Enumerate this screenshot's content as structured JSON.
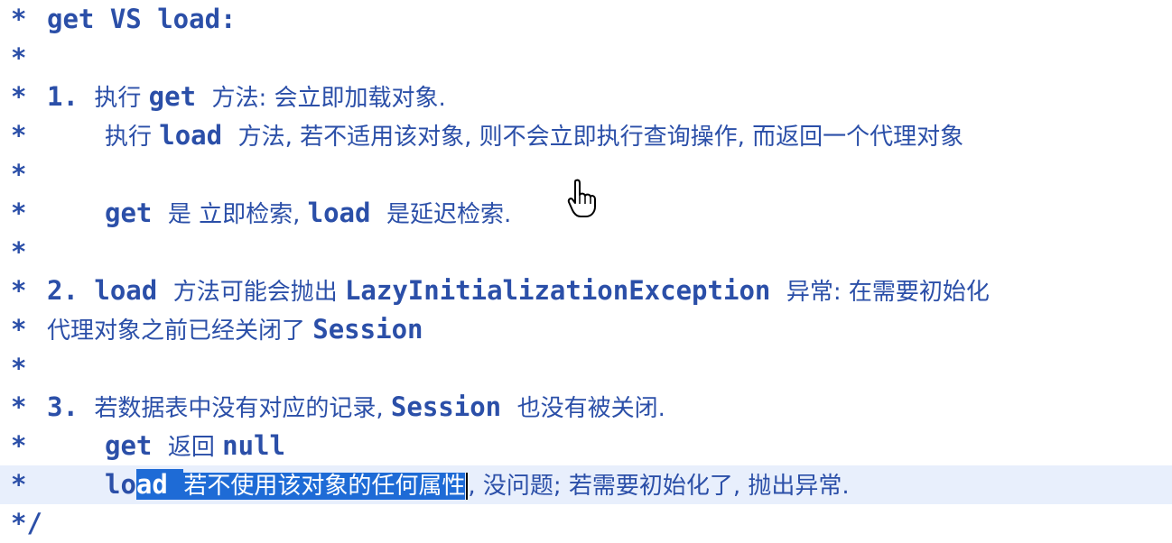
{
  "lines": [
    {
      "star": "*",
      "segments": [
        {
          "t": "get VS load:"
        }
      ]
    },
    {
      "star": "*",
      "segments": []
    },
    {
      "star": "*",
      "segments": [
        {
          "t": "1. "
        },
        {
          "t": "执行 ",
          "cjk": true
        },
        {
          "t": "get "
        },
        {
          "t": "方法: 会立即加载对象.",
          "cjk": true
        }
      ]
    },
    {
      "star": "*",
      "segments": [
        {
          "t": "执行 ",
          "cjk": true
        },
        {
          "t": "load "
        },
        {
          "t": "方法, 若不适用该对象, 则不会立即执行查询操作, 而返回一个代理对象",
          "cjk": true
        }
      ]
    },
    {
      "star": "*",
      "segments": []
    },
    {
      "star": "*",
      "segments": [
        {
          "t": "get "
        },
        {
          "t": "是 立即检索, ",
          "cjk": true
        },
        {
          "t": "load "
        },
        {
          "t": "是延迟检索.",
          "cjk": true
        }
      ]
    },
    {
      "star": "*",
      "segments": []
    },
    {
      "star": "*",
      "segments": [
        {
          "t": "2. load "
        },
        {
          "t": "方法可能会抛出 ",
          "cjk": true
        },
        {
          "t": "LazyInitializationException "
        },
        {
          "t": "异常: 在需要初始化",
          "cjk": true
        }
      ]
    },
    {
      "star": "*",
      "segments": [
        {
          "t": "代理对象之前已经关闭了 ",
          "cjk": true
        },
        {
          "t": "Session"
        }
      ]
    },
    {
      "star": "*",
      "segments": []
    },
    {
      "star": "*",
      "segments": [
        {
          "t": "3. "
        },
        {
          "t": "若数据表中没有对应的记录, ",
          "cjk": true
        },
        {
          "t": "Session "
        },
        {
          "t": "也没有被关闭.",
          "cjk": true
        }
      ]
    },
    {
      "star": "*",
      "segments": [
        {
          "t": "get "
        },
        {
          "t": "返回 ",
          "cjk": true
        },
        {
          "t": "null"
        }
      ]
    },
    {
      "star": "*",
      "segments": [
        {
          "t": "lo"
        },
        {
          "t": "ad ",
          "sel": true
        },
        {
          "t": "若不使用该对象的任何属性",
          "cjk": true,
          "sel": true
        },
        {
          "caret": true
        },
        {
          "t": ", 没问题; 若需要初始化了, 抛出异常.",
          "cjk": true
        }
      ]
    },
    {
      "star": "*/",
      "segments": []
    }
  ],
  "colors": {
    "text": "#2b4fa8",
    "selection": "#1e6bd6",
    "current_line": "#e8effc"
  },
  "cursor_icon": "hand-pointer-icon"
}
